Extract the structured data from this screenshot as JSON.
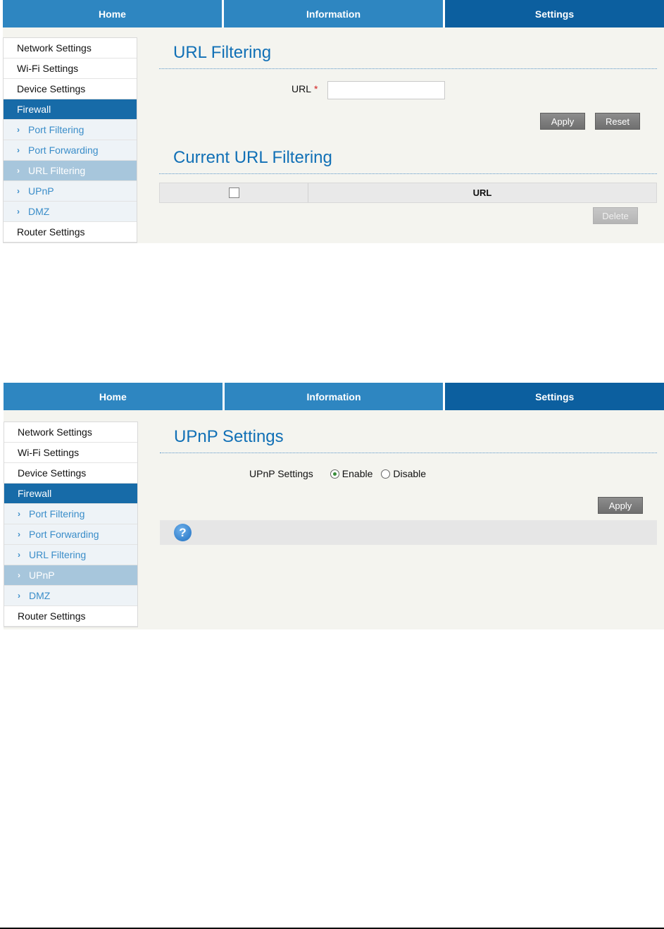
{
  "shot1": {
    "nav": [
      "Home",
      "Information",
      "Settings"
    ],
    "sidebar": {
      "network": "Network Settings",
      "wifi": "Wi-Fi Settings",
      "device": "Device Settings",
      "firewall": "Firewall",
      "subs": [
        "Port Filtering",
        "Port Forwarding",
        "URL Filtering",
        "UPnP",
        "DMZ"
      ],
      "router": "Router Settings"
    },
    "title": "URL Filtering",
    "url_label": "URL",
    "required_mark": "*",
    "url_value": "",
    "apply": "Apply",
    "reset": "Reset",
    "current_title": "Current URL Filtering",
    "table_header": "URL",
    "delete": "Delete"
  },
  "shot2": {
    "nav": [
      "Home",
      "Information",
      "Settings"
    ],
    "sidebar": {
      "network": "Network Settings",
      "wifi": "Wi-Fi Settings",
      "device": "Device Settings",
      "firewall": "Firewall",
      "subs": [
        "Port Filtering",
        "Port Forwarding",
        "URL Filtering",
        "UPnP",
        "DMZ"
      ],
      "router": "Router Settings"
    },
    "title": "UPnP Settings",
    "upnp_label": "UPnP Settings",
    "enable": "Enable",
    "disable": "Disable",
    "selected_option": "Enable",
    "apply": "Apply"
  },
  "colors": {
    "nav_blue": "#2e86c1",
    "nav_active": "#0c5f9f",
    "heading_blue": "#1170b6",
    "sidebar_active": "#176ba8",
    "submenu_text": "#3a8dc9"
  }
}
